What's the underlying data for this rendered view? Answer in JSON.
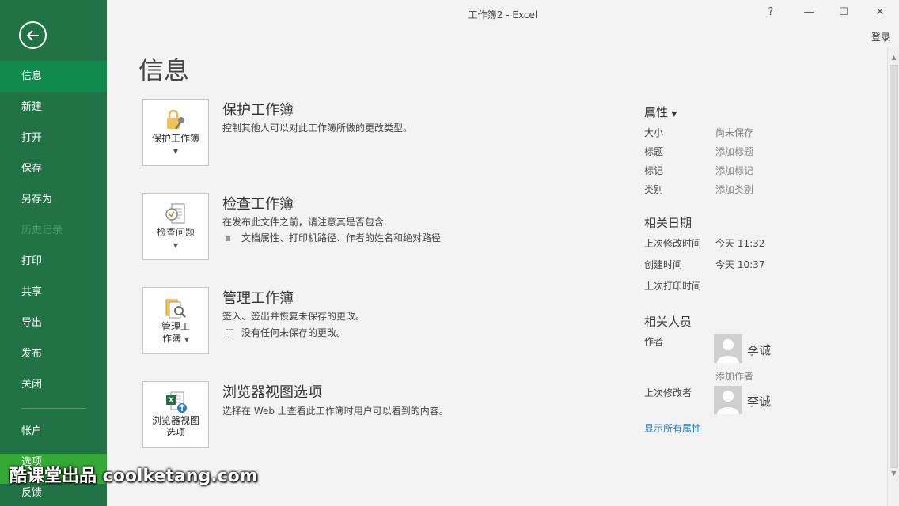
{
  "window": {
    "title": "工作簿2 - Excel",
    "help": "?",
    "minimize": "—",
    "maximize": "☐",
    "close": "✕",
    "login": "登录"
  },
  "sidebar": {
    "items": [
      {
        "label": "信息"
      },
      {
        "label": "新建"
      },
      {
        "label": "打开"
      },
      {
        "label": "保存"
      },
      {
        "label": "另存为"
      },
      {
        "label": "历史记录"
      },
      {
        "label": "打印"
      },
      {
        "label": "共享"
      },
      {
        "label": "导出"
      },
      {
        "label": "发布"
      },
      {
        "label": "关闭"
      }
    ],
    "bottom": [
      {
        "label": "帐户"
      },
      {
        "label": "选项"
      },
      {
        "label": "反馈"
      }
    ]
  },
  "main": {
    "title": "信息",
    "sections": [
      {
        "button": "保护工作簿",
        "title": "保护工作簿",
        "desc": "控制其他人可以对此工作簿所做的更改类型。"
      },
      {
        "button": "检查问题",
        "title": "检查工作簿",
        "desc": "在发布此文件之前，请注意其是否包含:",
        "bullet": "文档属性、打印机路径、作者的姓名和绝对路径"
      },
      {
        "button_line1": "管理工",
        "button_line2": "作簿",
        "title": "管理工作簿",
        "desc": "签入、签出并恢复未保存的更改。",
        "bullet": "没有任何未保存的更改。"
      },
      {
        "button_line1": "浏览器视图",
        "button_line2": "选项",
        "title": "浏览器视图选项",
        "desc": "选择在 Web 上查看此工作簿时用户可以看到的内容。"
      }
    ]
  },
  "properties": {
    "heading": "属性",
    "rows": [
      {
        "label": "大小",
        "value": "尚未保存"
      },
      {
        "label": "标题",
        "value": "添加标题"
      },
      {
        "label": "标记",
        "value": "添加标记"
      },
      {
        "label": "类别",
        "value": "添加类别"
      }
    ],
    "dates_heading": "相关日期",
    "dates": [
      {
        "label": "上次修改时间",
        "value": "今天 11:32"
      },
      {
        "label": "创建时间",
        "value": "今天 10:37"
      },
      {
        "label": "上次打印时间",
        "value": ""
      }
    ],
    "people_heading": "相关人员",
    "author_label": "作者",
    "author_name": "李诚",
    "add_author": "添加作者",
    "modified_by_label": "上次修改者",
    "modified_by_name": "李诚",
    "show_all": "显示所有属性"
  },
  "watermark": "酷课堂出品 coolketang.com"
}
